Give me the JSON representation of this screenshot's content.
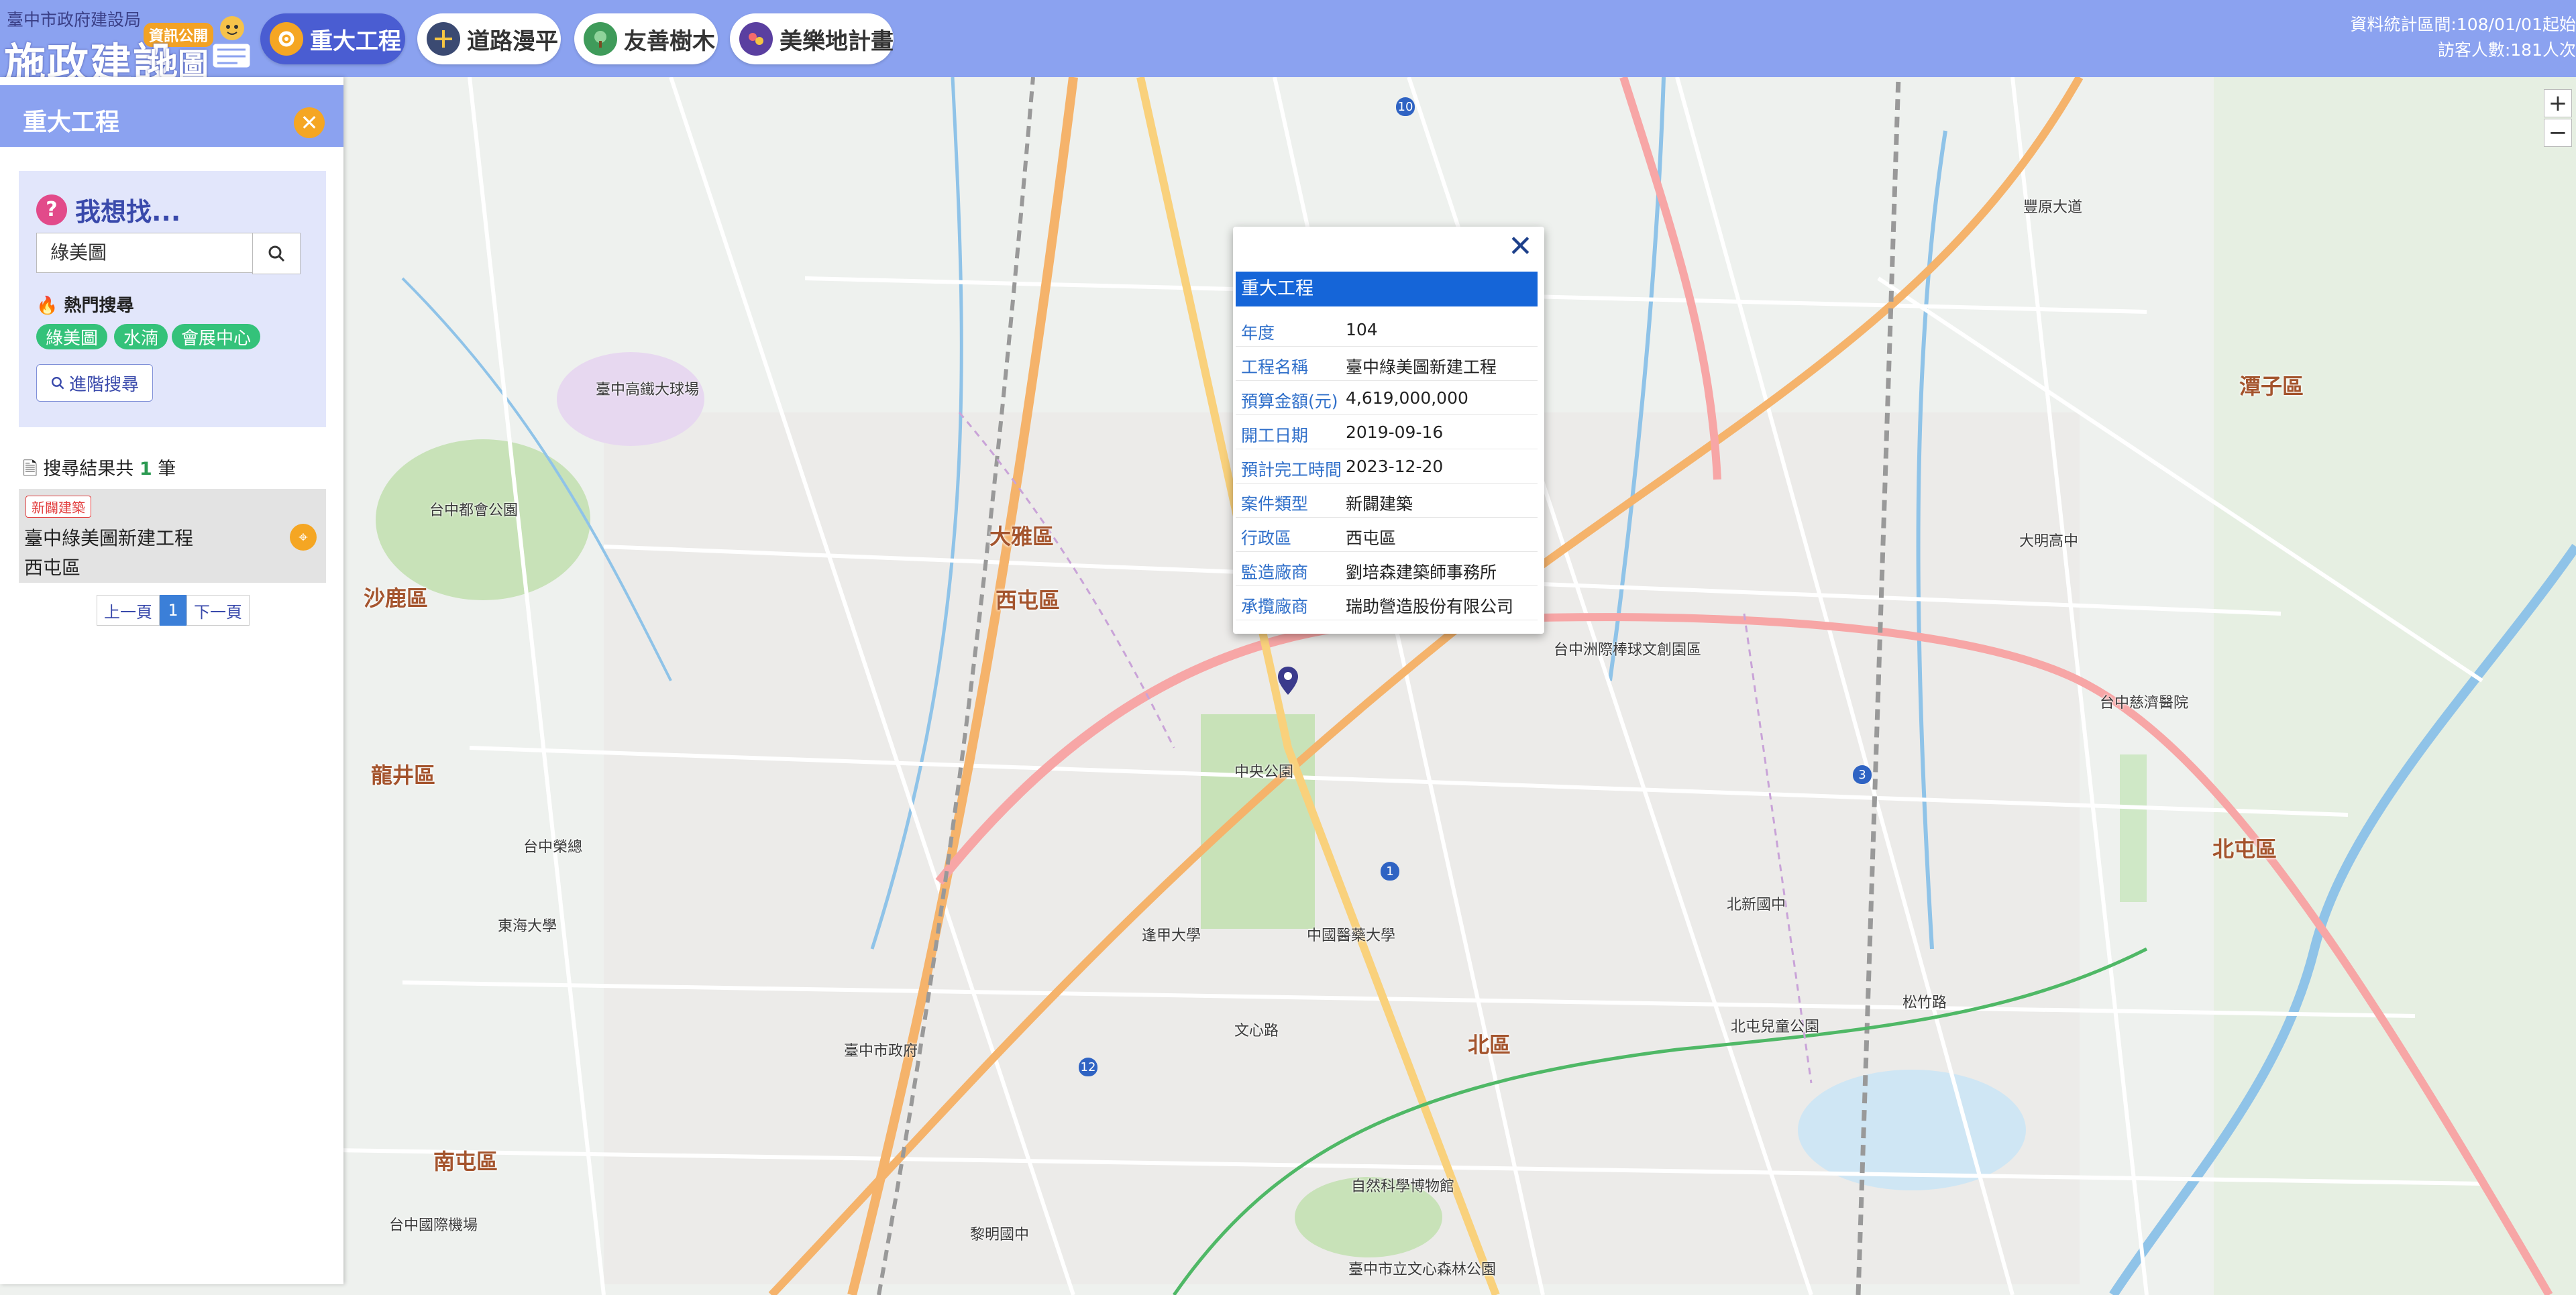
{
  "header": {
    "org": "臺中市政府建設局",
    "title_main": "施政建設",
    "title_map": "地圖",
    "badge": "資訊公開",
    "tabs": [
      {
        "label": "重大工程",
        "icon": "construction-icon",
        "active": true
      },
      {
        "label": "道路漫平",
        "icon": "road-icon",
        "active": false
      },
      {
        "label": "友善樹木",
        "icon": "tree-icon",
        "active": false
      },
      {
        "label": "美樂地計畫",
        "icon": "playground-icon",
        "active": false
      }
    ],
    "stats_line1": "資料統計區間:108/01/01起始",
    "stats_line2": "訪客人數:181人次"
  },
  "panel": {
    "title": "重大工程",
    "close_icon": "close-icon",
    "want_label": "我想找...",
    "search_value": "綠美圖",
    "hot_label": "熱門搜尋",
    "hot_tags": [
      "綠美圖",
      "水湳",
      "會展中心"
    ],
    "advanced_label": "進階搜尋",
    "result_prefix": "搜尋結果共",
    "result_count": "1",
    "result_suffix": "筆",
    "results": [
      {
        "badge": "新闢建築",
        "name": "臺中綠美圖新建工程",
        "district": "西屯區"
      }
    ],
    "pager": {
      "prev": "上一頁",
      "current": "1",
      "next": "下一頁"
    }
  },
  "popup": {
    "header": "重大工程",
    "rows": [
      {
        "key": "年度",
        "value": "104"
      },
      {
        "key": "工程名稱",
        "value": "臺中綠美圖新建工程"
      },
      {
        "key": "預算金額(元)",
        "value": "4,619,000,000"
      },
      {
        "key": "開工日期",
        "value": "2019-09-16"
      },
      {
        "key": "預計完工時間",
        "value": "2023-12-20"
      },
      {
        "key": "案件類型",
        "value": "新闢建築"
      },
      {
        "key": "行政區",
        "value": "西屯區"
      },
      {
        "key": "監造廠商",
        "value": "劉培森建築師事務所"
      },
      {
        "key": "承攬廠商",
        "value": "瑞助營造股份有限公司"
      }
    ]
  },
  "map": {
    "zoom_in": "+",
    "zoom_out": "−",
    "districts": [
      "大雅區",
      "西屯區",
      "沙鹿區",
      "龍井區",
      "南屯區",
      "北區",
      "潭子區",
      "北屯區"
    ],
    "places": [
      "臺中高鐵大球場",
      "台中都會公園",
      "台中榮總",
      "東海大學",
      "中央公園",
      "逢甲大學",
      "台中國際機場",
      "中國醫藥大學",
      "自然科學博物館",
      "文心路",
      "北屯兒童公園",
      "台中慈濟醫院",
      "大明高中",
      "台中洲際棒球文創園區",
      "臺中市政府",
      "黎明國中",
      "松竹路",
      "北新國中",
      "臺中市立文心森林公園",
      "豐原大道"
    ],
    "colors": {
      "land": "#eef1ee",
      "water": "#8fc3e8",
      "park": "#b8dca8",
      "road": "#ffffff",
      "highway": "#f5b36b",
      "rail": "#999999"
    }
  }
}
